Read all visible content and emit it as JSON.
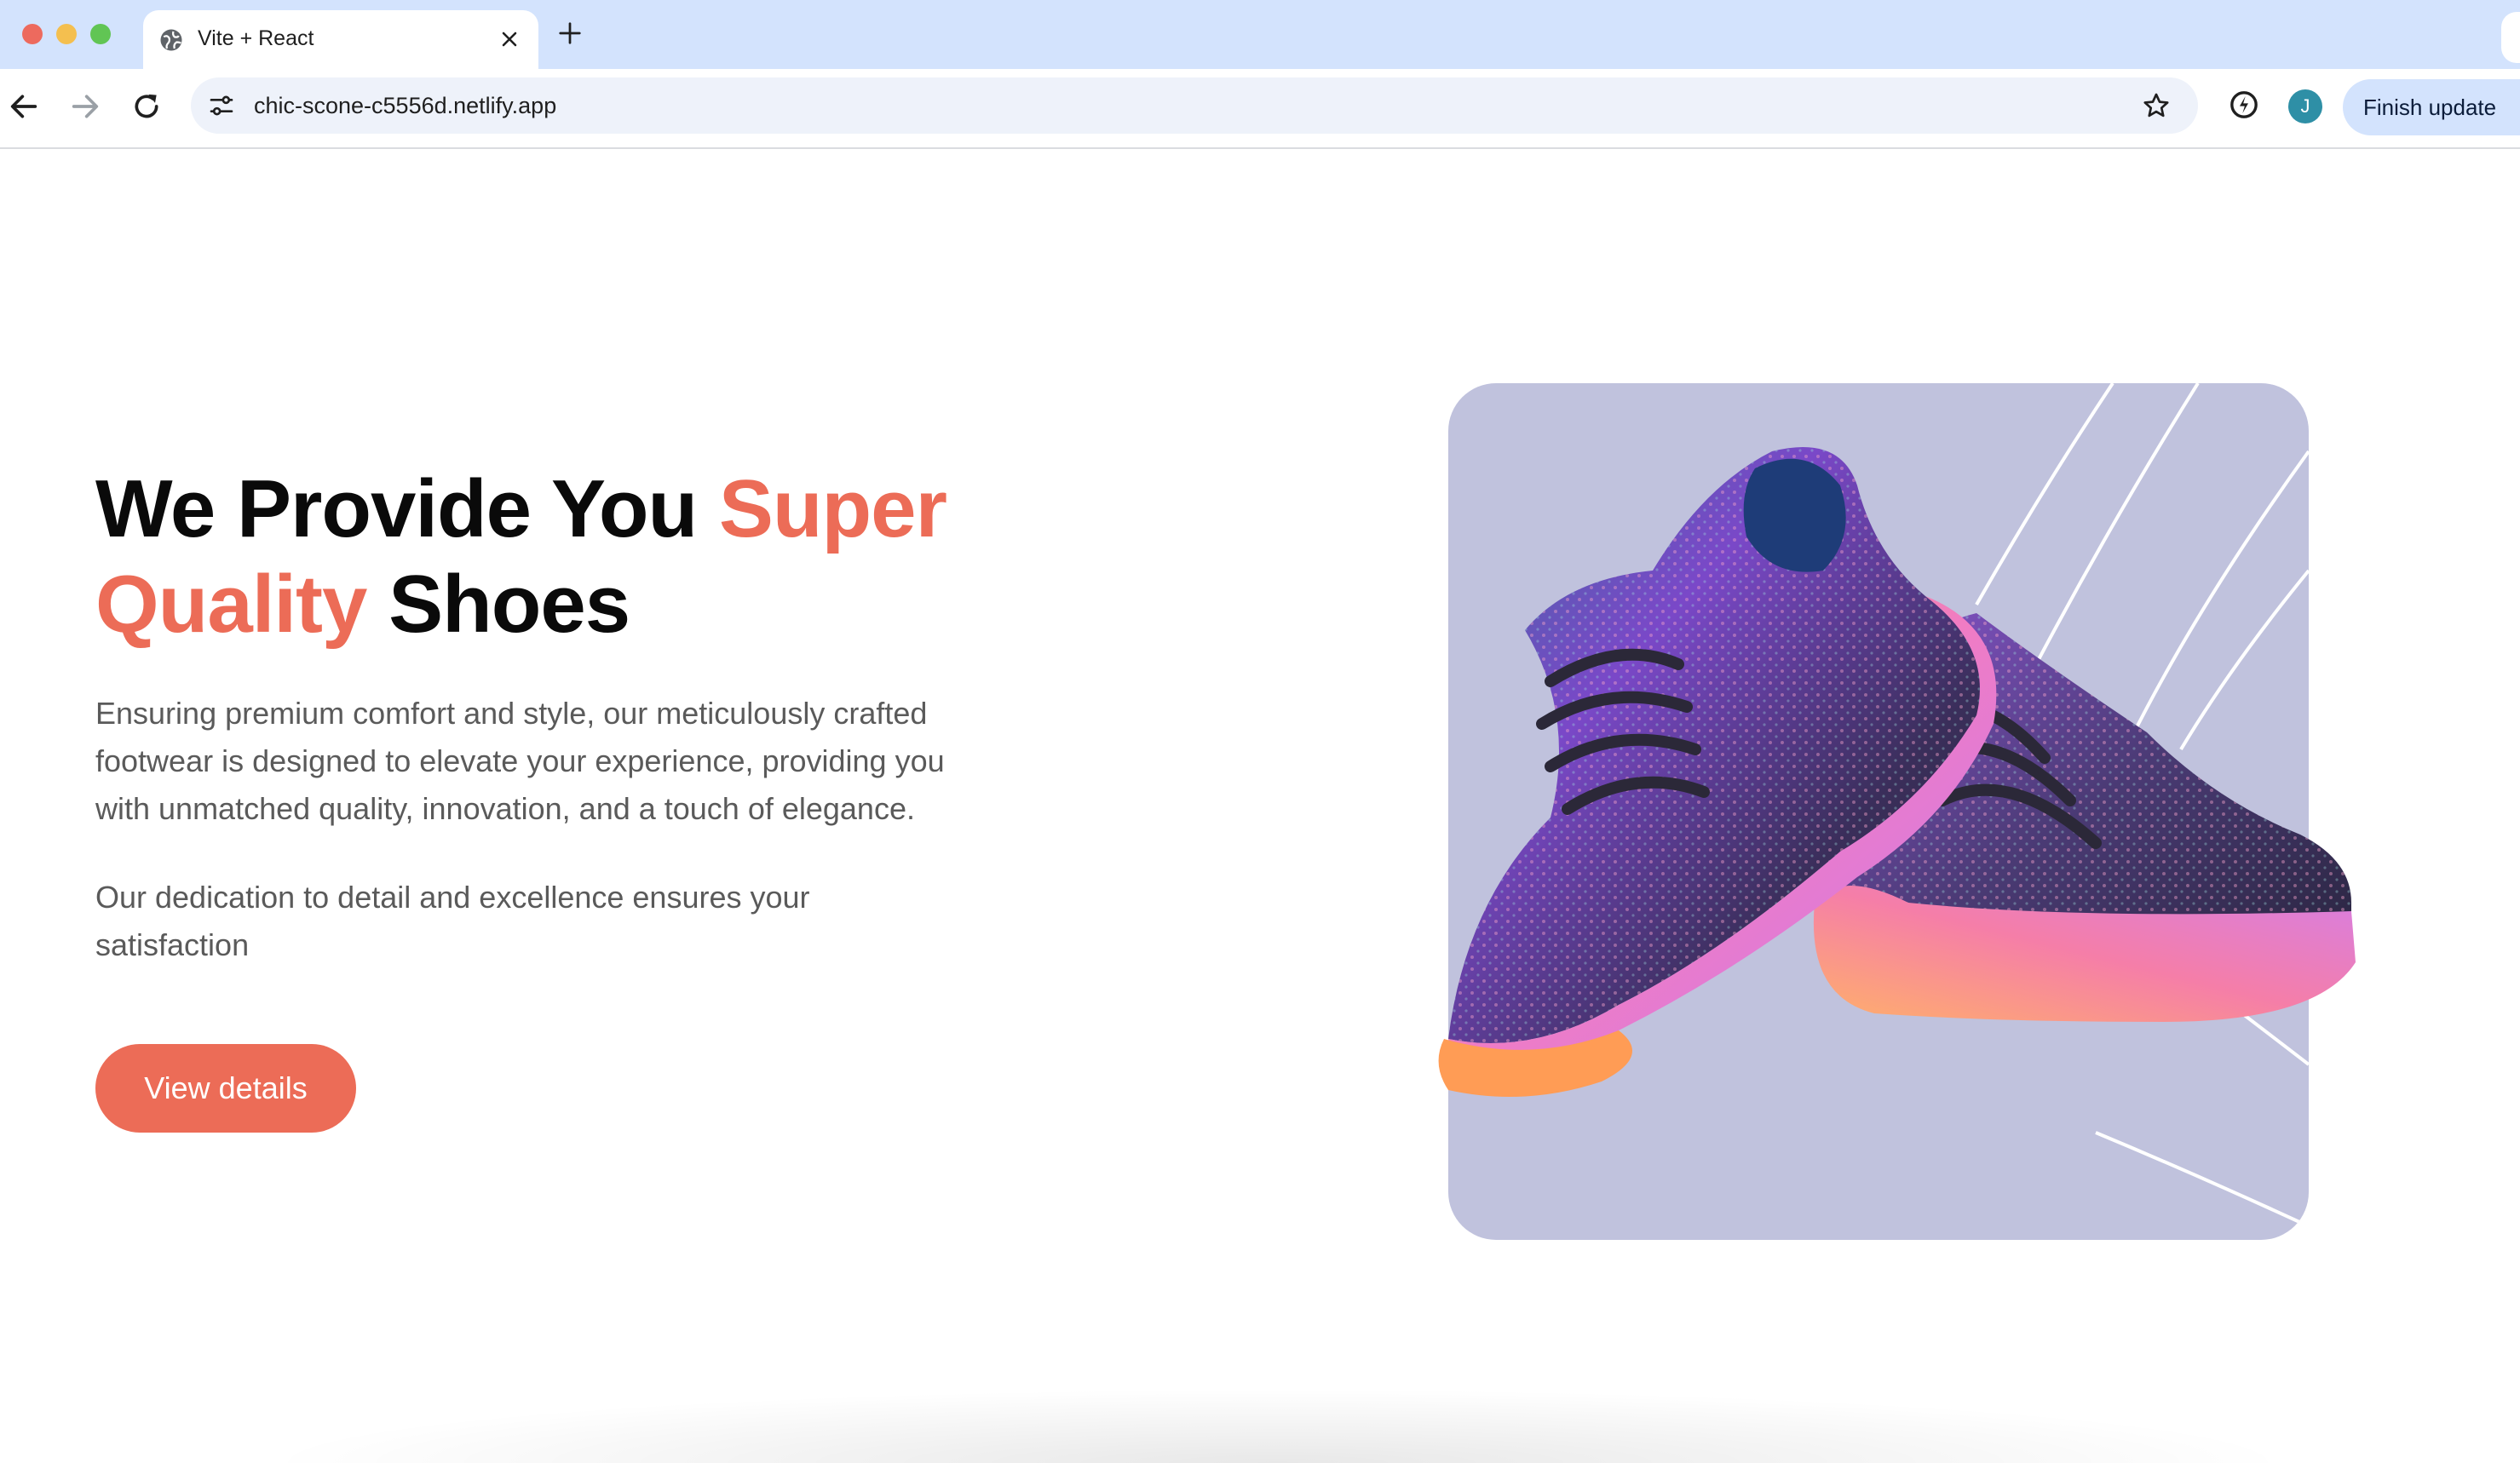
{
  "browser": {
    "tab_title": "Vite + React",
    "url": "chic-scone-c5556d.netlify.app",
    "avatar_initial": "J",
    "finish_update_label": "Finish update",
    "icons": [
      "globe-icon",
      "close-icon",
      "plus-icon",
      "back-arrow-icon",
      "forward-arrow-icon",
      "reload-icon",
      "site-settings-icon",
      "star-icon",
      "extension-icon"
    ]
  },
  "hero": {
    "headline_part1": "We Provide You ",
    "headline_accent1": "Super",
    "headline_accent2": "Quality",
    "headline_part2": " Shoes",
    "paragraph1": "Ensuring premium comfort and style, our meticulously crafted footwear is designed to elevate your experience, providing you with unmatched quality, innovation, and a touch of elegance.",
    "paragraph2": "Our dedication to detail and excellence ensures your satisfaction",
    "button_label": "View details",
    "colors": {
      "accent": "#ec6c57",
      "card_background": "#c0c2dd",
      "heading": "#0a0a0a",
      "body_text": "#5a5a5a"
    }
  }
}
